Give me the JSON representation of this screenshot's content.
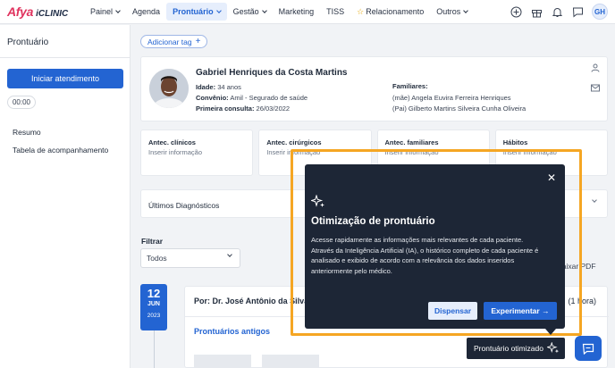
{
  "nav": {
    "logo_afya": "Afya",
    "logo_iclinic": "iCLINIC",
    "items": [
      {
        "label": "Painel",
        "chevron": true,
        "active": false
      },
      {
        "label": "Agenda",
        "chevron": false,
        "active": false
      },
      {
        "label": "Prontuário",
        "chevron": true,
        "active": true
      },
      {
        "label": "Gestão",
        "chevron": true,
        "active": false
      },
      {
        "label": "Marketing",
        "chevron": false,
        "active": false
      },
      {
        "label": "TISS",
        "chevron": false,
        "active": false
      },
      {
        "label": "Relacionamento",
        "chevron": false,
        "active": false,
        "star": true
      },
      {
        "label": "Outros",
        "chevron": true,
        "active": false
      }
    ],
    "avatar_initials": "GH",
    "icons": [
      "plus-circle-icon",
      "gift-icon",
      "bell-icon",
      "message-icon"
    ]
  },
  "sidebar": {
    "title": "Prontuário",
    "start_button": "Iniciar atendimento",
    "timer": "00:00",
    "links": [
      "Resumo",
      "Tabela de acompanhamento"
    ]
  },
  "main": {
    "add_tag": "Adicionar tag",
    "patient": {
      "name": "Gabriel Henriques da Costa Martins",
      "age_label": "Idade:",
      "age_value": "34 anos",
      "insurance_label": "Convênio:",
      "insurance_value": "Amil - Segurado de saúde",
      "first_visit_label": "Primeira consulta:",
      "first_visit_value": "26/03/2022",
      "family_title": "Familiares:",
      "family": [
        "(mãe) Angela Euvira Ferreira Henriques",
        "(Pai) Gilberto Martins Silveira Cunha Oliveira"
      ]
    },
    "antecedents": [
      {
        "title": "Antec. clínicos",
        "placeholder": "Inserir informação"
      },
      {
        "title": "Antec. cirúrgicos",
        "placeholder": "Inserir informação"
      },
      {
        "title": "Antec. familiares",
        "placeholder": "Inserir informação"
      },
      {
        "title": "Hábitos",
        "placeholder": "Inserir informação"
      }
    ],
    "diagnostics_title": "Últimos Diagnósticos",
    "filter_label": "Filtrar",
    "filter_value": "Todos",
    "pdf_text": "baixar PDF",
    "date": {
      "day": "12",
      "month": "JUN",
      "year": "2023"
    },
    "entry_by": "Por: Dr. José Antônio da Silva",
    "entry_time": "(1 hora)",
    "old_records": "Prontuários antigos"
  },
  "popover": {
    "title": "Otimização de prontuário",
    "body_1": "Acesse rapidamente as informações mais relevantes de cada paciente.",
    "body_2": "Através da Inteligência Artificial (IA), o histórico completo de cada paciente é analisado e exibido de acordo com a relevância dos dados inseridos anteriormente pelo médico.",
    "dismiss": "Dispensar",
    "try": "Experimentar"
  },
  "optimized_button": "Prontuário otimizado",
  "colors": {
    "brand_blue": "#2364d2",
    "dark_popover": "#1d2636",
    "highlight": "#f5a623",
    "logo_pink": "#e0335e"
  }
}
